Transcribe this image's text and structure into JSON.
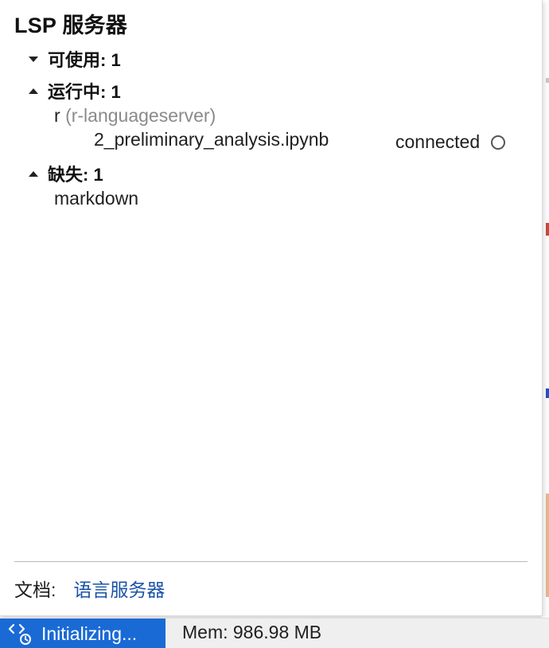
{
  "popup": {
    "title": "LSP 服务器",
    "available": {
      "label": "可使用: 1"
    },
    "running": {
      "label": "运行中: 1",
      "server_name": "r",
      "server_id": "(r-languageserver)",
      "document": "2_preliminary_analysis.ipynb",
      "status": "connected"
    },
    "missing": {
      "label": "缺失: 1",
      "items": [
        "markdown"
      ]
    },
    "footer": {
      "docs_label": "文档:",
      "docs_link": "语言服务器"
    }
  },
  "statusbar": {
    "lsp_status": "Initializing...",
    "memory": "Mem: 986.98 MB"
  },
  "colors": {
    "accent": "#1a6ad6",
    "link": "#1a52a8",
    "muted_text": "#8a8a8a"
  },
  "icons": {
    "caret_available": "caret-down-icon",
    "caret_running": "caret-up-icon",
    "caret_missing": "caret-up-icon",
    "status_indicator": "circle-outline-icon",
    "lsp": "code-brackets-icon"
  }
}
